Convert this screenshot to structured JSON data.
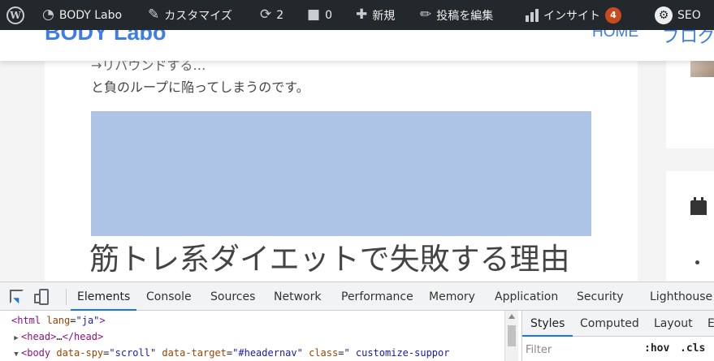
{
  "admin_bar": {
    "site_name": "BODY Labo",
    "customize": "カスタマイズ",
    "updates_count": "2",
    "comments_count": "0",
    "new_label": "新規",
    "edit_post": "投稿を編集",
    "insight": "インサイト",
    "insight_badge": "4",
    "seo": "SEO"
  },
  "site_header": {
    "title": "BODY Labo",
    "nav_home": "HOME",
    "nav_blog": "ブログ"
  },
  "article": {
    "cut_text": "→リバウンドする…",
    "loop_text": "と負のループに陥ってしまうのです。",
    "heading": "筋トレ系ダイエットで失敗する理由",
    "placeholder_color": "#adc4e6"
  },
  "devtools": {
    "tabs": [
      "Elements",
      "Console",
      "Sources",
      "Network",
      "Performance",
      "Memory",
      "Application",
      "Security",
      "Lighthouse"
    ],
    "active_tab": "Elements",
    "dom": {
      "html_open": "<html ",
      "html_attr": "lang",
      "html_val": "\"ja\"",
      "html_close": ">",
      "head_open": "<head>",
      "head_ellipsis": "…",
      "head_close": "</head>",
      "body_open": "<body ",
      "body_attr1": "data-spy",
      "body_val1": "\"scroll\"",
      "body_attr2": "data-target",
      "body_val2": "\"#headernav\"",
      "body_attr3": "class",
      "body_val3": "\" customize-suppor"
    },
    "styles_tabs": [
      "Styles",
      "Computed",
      "Layout",
      "E"
    ],
    "filter_placeholder": "Filter",
    "hov": ":hov",
    "cls": ".cls"
  },
  "colors": {
    "admin_bar_bg": "#23282d",
    "link_blue": "#3d7de8",
    "badge": "#ca4a1f",
    "devtools_accent": "#1a73e8"
  }
}
